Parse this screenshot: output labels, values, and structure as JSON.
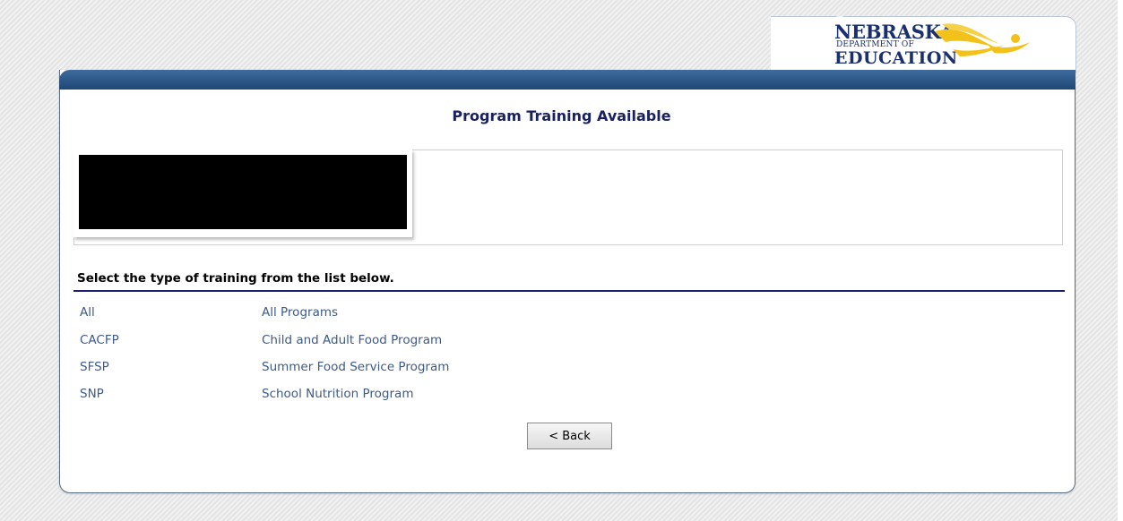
{
  "header": {
    "logo_line1": "NEBRASKA",
    "logo_line2": "DEPARTMENT OF",
    "logo_line3": "EDUCATION"
  },
  "main": {
    "title": "Program Training Available",
    "instruction": "Select the type of training from the list below.",
    "programs": [
      {
        "code": "All",
        "name": "All Programs"
      },
      {
        "code": "CACFP",
        "name": "Child and Adult Food Program"
      },
      {
        "code": "SFSP",
        "name": "Summer Food Service Program"
      },
      {
        "code": "SNP",
        "name": "School Nutrition Program"
      }
    ],
    "back_label": "< Back"
  },
  "colors": {
    "title": "#1a2160",
    "link": "#3c5a8a",
    "header_bar": "#2a5585",
    "logo_blue": "#1a2f6e",
    "logo_gold": "#f2c21b"
  }
}
